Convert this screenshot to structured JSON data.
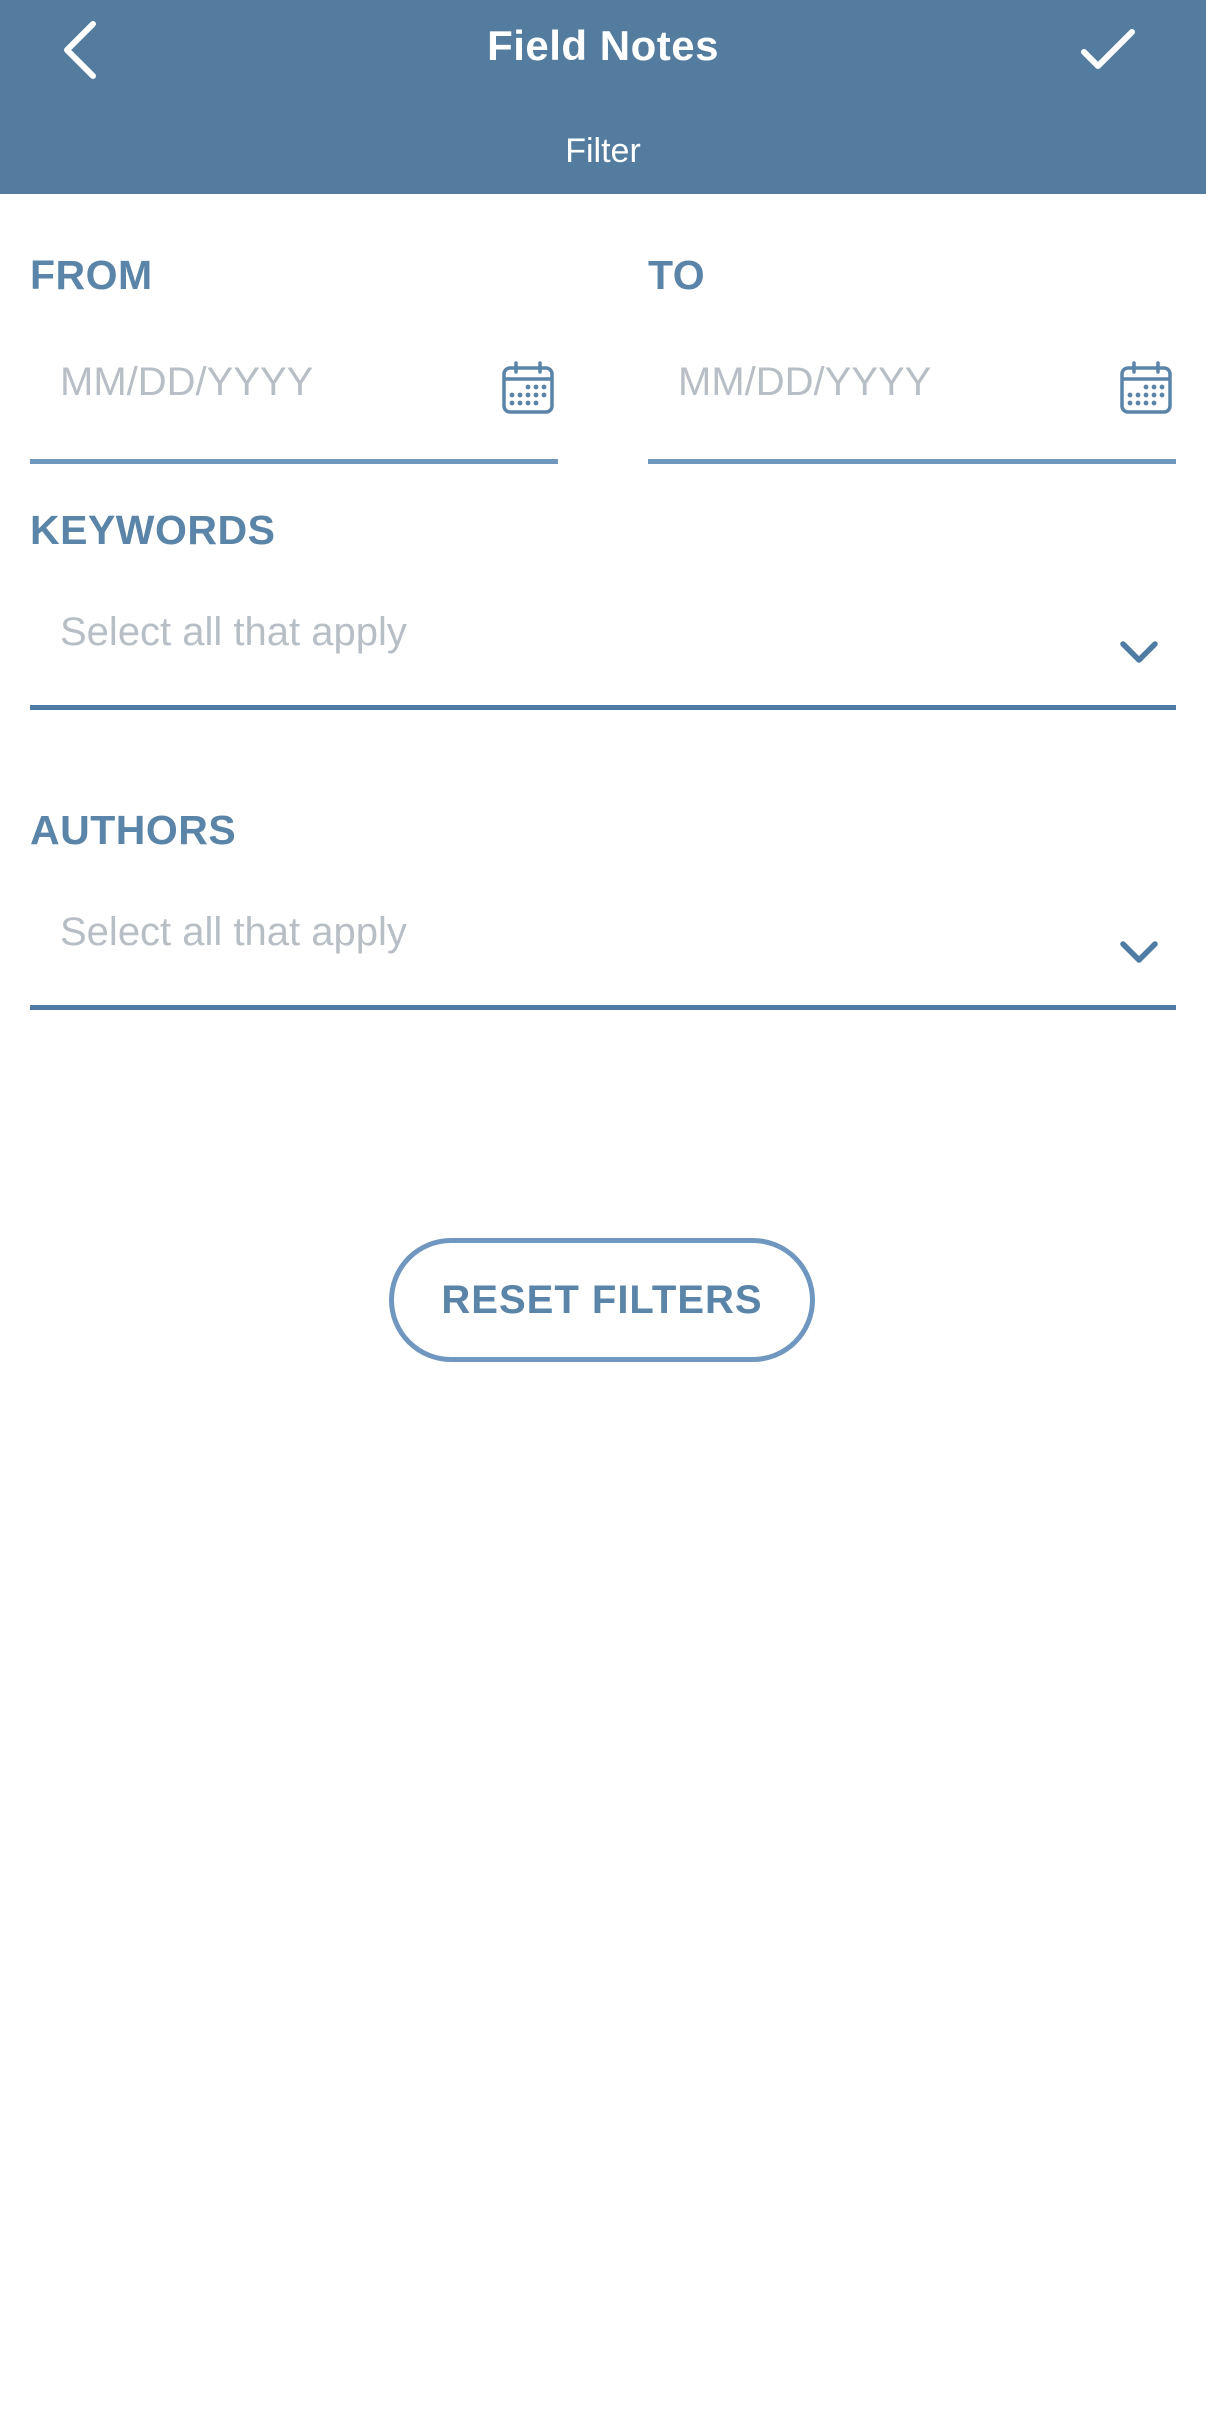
{
  "header": {
    "title": "Field Notes",
    "subtitle": "Filter",
    "back_icon": "chevron-left-icon",
    "confirm_icon": "checkmark-icon",
    "background_color": "#537c9f"
  },
  "filters": {
    "from": {
      "label": "FROM",
      "placeholder": "MM/DD/YYYY",
      "icon": "calendar-icon"
    },
    "to": {
      "label": "TO",
      "placeholder": "MM/DD/YYYY",
      "icon": "calendar-icon"
    },
    "keywords": {
      "label": "KEYWORDS",
      "placeholder": "Select all that apply",
      "icon": "chevron-down-icon"
    },
    "authors": {
      "label": "AUTHORS",
      "placeholder": "Select all that apply",
      "icon": "chevron-down-icon"
    }
  },
  "reset_button": {
    "label": "RESET FILTERS"
  },
  "colors": {
    "accent": "#5a84a8",
    "field_line": "#6f97bf",
    "placeholder": "#b7bec6"
  }
}
